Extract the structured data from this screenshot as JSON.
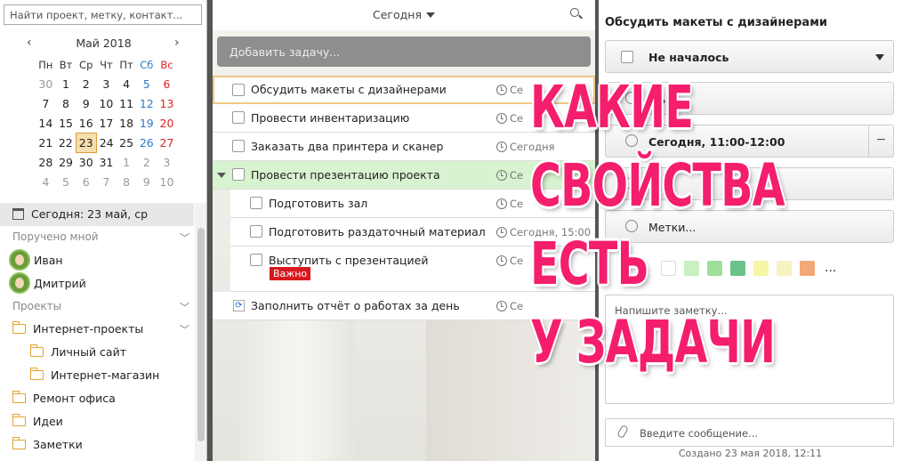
{
  "search": {
    "placeholder": "Найти проект, метку, контакт..."
  },
  "calendar": {
    "month": "Май 2018",
    "weekdays": [
      "Пн",
      "Вт",
      "Ср",
      "Чт",
      "Пт",
      "Сб",
      "Вс"
    ],
    "weeks": [
      [
        "30",
        "1",
        "2",
        "3",
        "4",
        "5",
        "6"
      ],
      [
        "7",
        "8",
        "9",
        "10",
        "11",
        "12",
        "13"
      ],
      [
        "14",
        "15",
        "16",
        "17",
        "18",
        "19",
        "20"
      ],
      [
        "21",
        "22",
        "23",
        "24",
        "25",
        "26",
        "27"
      ],
      [
        "28",
        "29",
        "30",
        "31",
        "1",
        "2",
        "3"
      ],
      [
        "4",
        "5",
        "6",
        "7",
        "8",
        "9",
        "10"
      ]
    ]
  },
  "sidebar": {
    "today": "Сегодня: 23 май, ср",
    "assigned_header": "Поручено мной",
    "people": [
      "Иван",
      "Дмитрий"
    ],
    "projects_header": "Проекты",
    "projects": [
      "Интернет-проекты",
      "Личный сайт",
      "Интернет-магазин",
      "Ремонт офиса",
      "Идеи",
      "Заметки"
    ]
  },
  "main": {
    "header": "Сегодня",
    "add_task": "Добавить задачу...",
    "tasks": [
      {
        "title": "Обсудить макеты с дизайнерами",
        "date": "Се"
      },
      {
        "title": "Провести инвентаризацию",
        "date": "Се"
      },
      {
        "title": "Заказать два принтера и сканер",
        "date": "Сегодня"
      },
      {
        "title": "Провести презентацию проекта",
        "date": "Се"
      },
      {
        "title": "Подготовить зал",
        "date": "Се"
      },
      {
        "title": "Подготовить раздаточный материал",
        "date": "Сегодня, 15:00"
      },
      {
        "title": "Выступить с презентацией",
        "date": "Се"
      },
      {
        "title": "Заполнить отчёт о работах за день",
        "date": "Се"
      }
    ],
    "badge": "Важно"
  },
  "detail": {
    "title": "Обсудить макеты с дизайнерами",
    "status": "Не началось",
    "assignee": "...ь...",
    "schedule": "Сегодня, 11:00-12:00",
    "project": "...",
    "tags": "Метки...",
    "colors": [
      "#ffffff",
      "#c9f0c0",
      "#9fdf9a",
      "#6cc28a",
      "#f7f5a6",
      "#f6f2c2",
      "#f2a877"
    ],
    "more": "...",
    "note_placeholder": "Напишите заметку...",
    "message_placeholder": "Введите сообщение...",
    "created": "Создано 23 мая 2018, 12:11"
  },
  "overlay": [
    "КАКИЕ",
    "СВОЙСТВА",
    "ЕСТЬ",
    "У ЗАДАЧИ"
  ]
}
